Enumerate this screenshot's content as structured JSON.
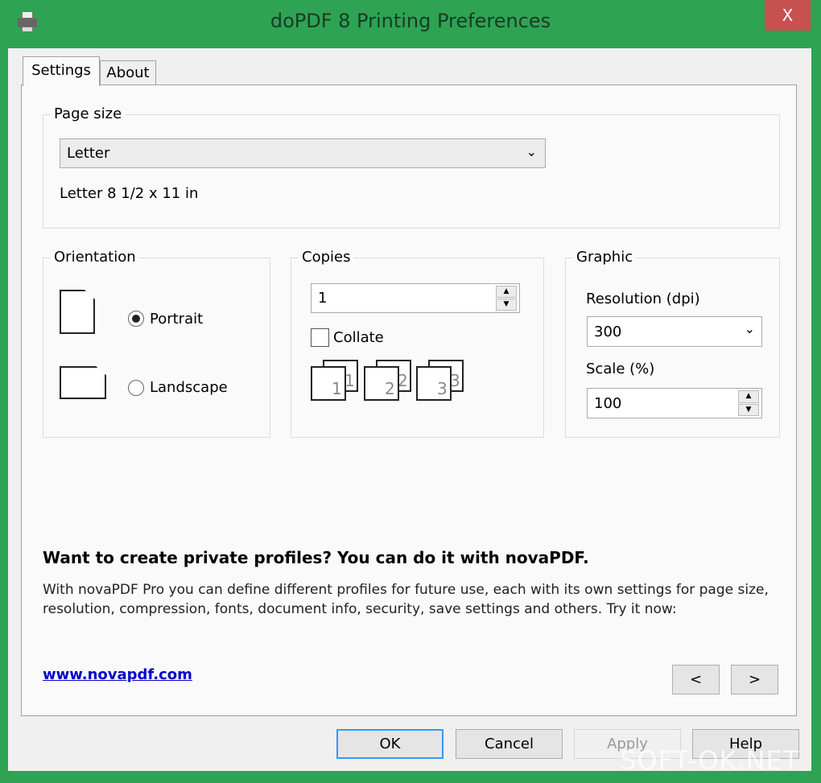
{
  "window": {
    "title": "doPDF 8 Printing Preferences",
    "close": "X",
    "icon": "printer-icon"
  },
  "tabs": [
    {
      "label": "Settings",
      "active": true
    },
    {
      "label": "About"
    }
  ],
  "page_size": {
    "label": "Page size",
    "selected": "Letter",
    "description": "Letter 8 1/2 x 11 in"
  },
  "orientation": {
    "label": "Orientation",
    "portrait": "Portrait",
    "landscape": "Landscape",
    "selected": "Portrait"
  },
  "copies": {
    "label": "Copies",
    "value": "1",
    "collate": "Collate",
    "collate_checked": false,
    "pages": [
      "1",
      "2",
      "3"
    ]
  },
  "graphic": {
    "label": "Graphic",
    "resolution_label": "Resolution (dpi)",
    "resolution": "300",
    "scale_label": "Scale (%)",
    "scale": "100"
  },
  "promo": {
    "heading": "Want to create private profiles? You can do it with novaPDF.",
    "body": "With novaPDF Pro you can define different profiles for future use, each with its own settings for page size, resolution, compression, fonts, document info, security, save settings and others. Try it now:",
    "link": "www.novapdf.com",
    "prev": "<",
    "next": ">"
  },
  "buttons": {
    "ok": "OK",
    "cancel": "Cancel",
    "apply": "Apply",
    "help": "Help"
  },
  "watermark": "SOFT-OK.NET",
  "colors": {
    "frame": "#2ea354",
    "close": "#c75050",
    "link": "#0000cc",
    "focus": "#3399ff"
  }
}
